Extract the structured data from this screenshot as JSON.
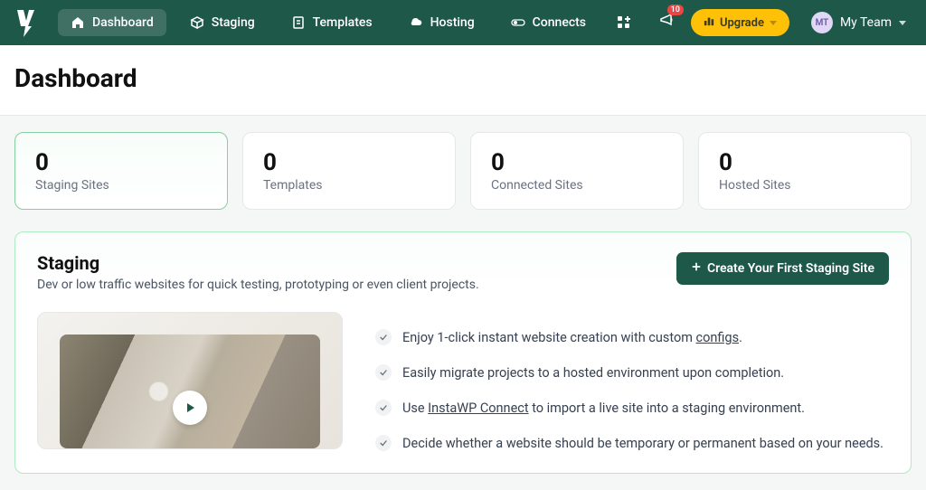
{
  "nav": {
    "items": [
      {
        "label": "Dashboard"
      },
      {
        "label": "Staging"
      },
      {
        "label": "Templates"
      },
      {
        "label": "Hosting"
      },
      {
        "label": "Connects"
      }
    ],
    "notification_count": "10",
    "upgrade_label": "Upgrade",
    "team": {
      "initials": "MT",
      "name": "My Team"
    }
  },
  "page": {
    "title": "Dashboard"
  },
  "stats": [
    {
      "value": "0",
      "label": "Staging Sites"
    },
    {
      "value": "0",
      "label": "Templates"
    },
    {
      "value": "0",
      "label": "Connected Sites"
    },
    {
      "value": "0",
      "label": "Hosted Sites"
    }
  ],
  "staging": {
    "title": "Staging",
    "description": "Dev or low traffic websites for quick testing, prototyping or even client projects.",
    "create_label": "Create Your First Staging Site",
    "features": {
      "f1_pre": "Enjoy 1-click instant website creation with custom ",
      "f1_link": "configs",
      "f1_post": ".",
      "f2": "Easily migrate projects to a hosted environment upon completion.",
      "f3_pre": "Use ",
      "f3_link": "InstaWP Connect",
      "f3_post": " to import a live site into a staging environment.",
      "f4": "Decide whether a website should be temporary or permanent based on your needs."
    }
  }
}
